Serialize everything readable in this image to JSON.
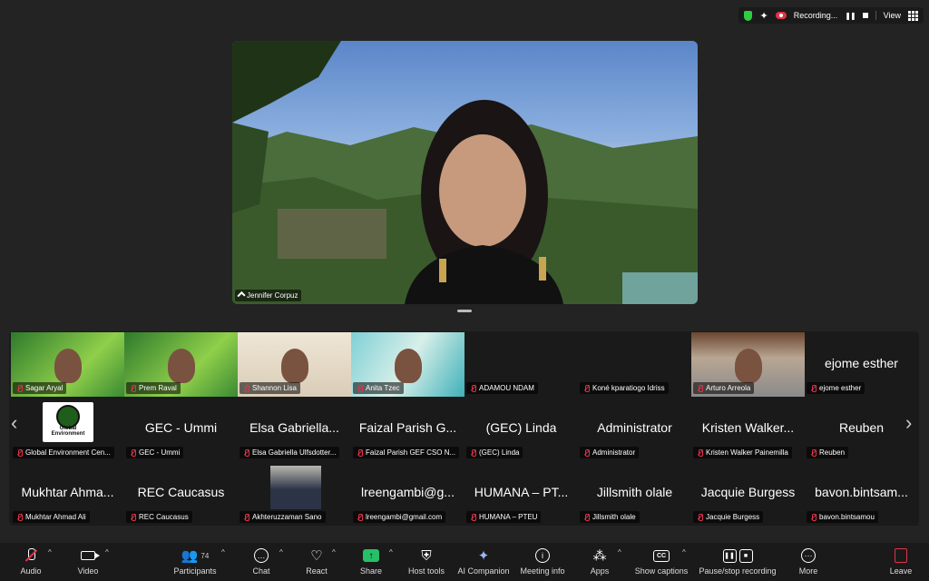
{
  "status": {
    "recording_label": "Recording...",
    "view_label": "View"
  },
  "speaker": {
    "name": "Jennifer Corpuz"
  },
  "gallery_rows": [
    [
      {
        "name": "Sagar Aryal",
        "kind": "video",
        "style": "vid-green"
      },
      {
        "name": "Prem Raval",
        "kind": "video",
        "style": "vid-green"
      },
      {
        "name": "Shannon Lisa",
        "kind": "video",
        "style": "vid-beige"
      },
      {
        "name": "Anita Tzec",
        "kind": "video",
        "style": "vid-ocean"
      },
      {
        "name": "ADAMOU NDAM",
        "kind": "thumb",
        "style": "vid-pink"
      },
      {
        "name": "Koné kparatiogo Idriss",
        "kind": "thumb",
        "style": "vid-room"
      },
      {
        "name": "Arturo Arreola",
        "kind": "video",
        "style": "vid-wood"
      },
      {
        "name": "ejome esther",
        "big": "ejome esther",
        "kind": "text"
      }
    ],
    [
      {
        "name": "Global Environment Cen...",
        "kind": "logo",
        "logo_label": "Global Environment"
      },
      {
        "name": "GEC - Ummi",
        "big": "GEC - Ummi",
        "kind": "text"
      },
      {
        "name": "Elsa Gabriella Ulfsdotter...",
        "big": "Elsa Gabriella...",
        "kind": "text"
      },
      {
        "name": "Faizal Parish GEF CSO N...",
        "big": "Faizal Parish G...",
        "kind": "text"
      },
      {
        "name": "(GEC) Linda",
        "big": "(GEC) Linda",
        "kind": "text"
      },
      {
        "name": "Administrator",
        "big": "Administrator",
        "kind": "text"
      },
      {
        "name": "Kristen Walker Painemilla",
        "big": "Kristen Walker...",
        "kind": "text"
      },
      {
        "name": "Reuben",
        "big": "Reuben",
        "kind": "text"
      }
    ],
    [
      {
        "name": "Mukhtar Ahmad Ali",
        "big": "Mukhtar Ahma...",
        "kind": "text"
      },
      {
        "name": "REC Caucasus",
        "big": "REC Caucasus",
        "kind": "text"
      },
      {
        "name": "Akhteruzzaman Sano",
        "kind": "photo"
      },
      {
        "name": "lreengambi@gmail.com",
        "big": "lreengambi@g...",
        "kind": "text"
      },
      {
        "name": "HUMANA – PTEU",
        "big": "HUMANA – PT...",
        "kind": "text"
      },
      {
        "name": "Jillsmith olale",
        "big": "Jillsmith olale",
        "kind": "text"
      },
      {
        "name": "Jacquie Burgess",
        "big": "Jacquie Burgess",
        "kind": "text"
      },
      {
        "name": "bavon.bintsamou",
        "big": "bavon.bintsam...",
        "kind": "text"
      }
    ]
  ],
  "toolbar": {
    "audio": "Audio",
    "video": "Video",
    "participants": "Participants",
    "participants_count": "74",
    "chat": "Chat",
    "react": "React",
    "share": "Share",
    "host_tools": "Host tools",
    "ai_companion": "AI Companion",
    "meeting_info": "Meeting info",
    "apps": "Apps",
    "show_captions": "Show captions",
    "recording": "Pause/stop recording",
    "more": "More",
    "leave": "Leave"
  },
  "colors": {
    "mute_red": "#e0334b",
    "share_green": "#26c066",
    "background": "#232323"
  }
}
